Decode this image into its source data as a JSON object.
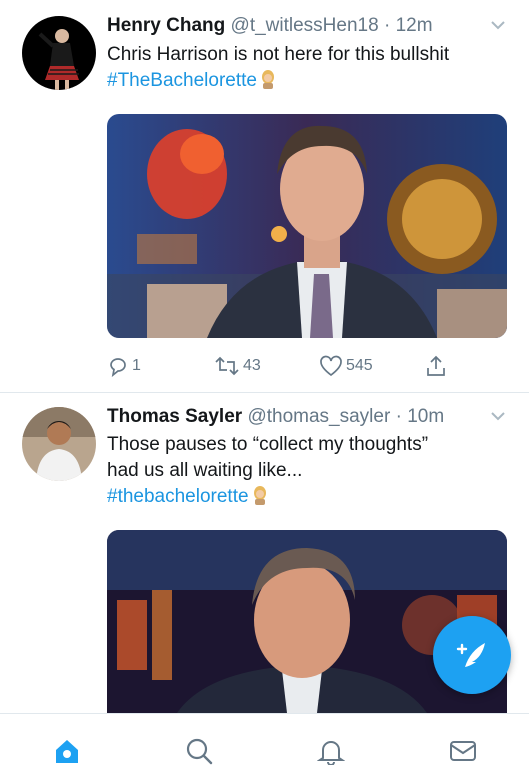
{
  "colors": {
    "accent": "#1da1f2",
    "hashtag": "#1b95e0",
    "secondary_text": "#657786",
    "active_tab": "#1da1f2"
  },
  "tweets": [
    {
      "name": "Henry Chang",
      "handle": "@t_witlessHen18",
      "dot": "·",
      "time": "12m",
      "text_lines": [
        "Chris Harrison is not here for this bullshit"
      ],
      "hashtag": "#TheBachelorette",
      "actions": {
        "replies": "1",
        "retweets": "43",
        "likes": "545"
      }
    },
    {
      "name": "Thomas Sayler",
      "handle": "@thomas_sayler",
      "dot": "·",
      "time": "10m",
      "text_lines": [
        "Those pauses to “collect my thoughts”",
        "had us all waiting like..."
      ],
      "hashtag": "#thebachelorette"
    }
  ],
  "icons": {
    "reply": "reply-icon",
    "retweet": "retweet-icon",
    "like": "heart-icon",
    "share": "share-icon",
    "compose": "compose-icon",
    "tabs": [
      "home-icon",
      "search-icon",
      "notifications-icon",
      "messages-icon"
    ]
  }
}
